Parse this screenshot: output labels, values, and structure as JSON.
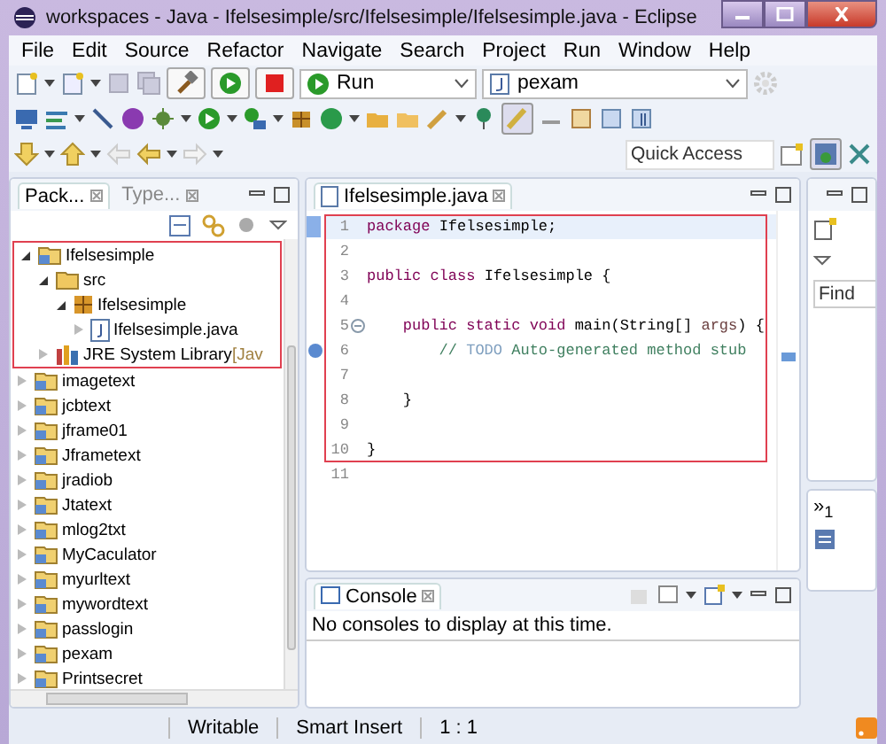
{
  "window": {
    "title": "workspaces - Java - Ifelsesimple/src/Ifelsesimple/Ifelsesimple.java - Eclipse"
  },
  "menu": [
    "File",
    "Edit",
    "Source",
    "Refactor",
    "Navigate",
    "Search",
    "Project",
    "Run",
    "Window",
    "Help"
  ],
  "toolbar": {
    "run_config": "Run",
    "launch_target": "pexam",
    "quick_access": {
      "placeholder": "Quick Access"
    }
  },
  "explorer": {
    "tabs": [
      {
        "label": "Pack...",
        "selected": true
      },
      {
        "label": "Type...",
        "selected": false
      }
    ],
    "tree": [
      {
        "label": "Ifelsesimple",
        "kind": "project",
        "expanded": true,
        "children": [
          {
            "label": "src",
            "kind": "folder",
            "expanded": true,
            "children": [
              {
                "label": "Ifelsesimple",
                "kind": "package",
                "expanded": true,
                "children": [
                  {
                    "label": "Ifelsesimple.java",
                    "kind": "java",
                    "expanded": false
                  }
                ]
              }
            ]
          },
          {
            "label": "JRE System Library",
            "suffix": "[Jav",
            "kind": "library",
            "expanded": false
          }
        ]
      },
      {
        "label": "imagetext",
        "kind": "project",
        "expanded": false
      },
      {
        "label": "jcbtext",
        "kind": "project",
        "expanded": false
      },
      {
        "label": "jframe01",
        "kind": "project",
        "expanded": false
      },
      {
        "label": "Jframetext",
        "kind": "project",
        "expanded": false
      },
      {
        "label": "jradiob",
        "kind": "project",
        "expanded": false
      },
      {
        "label": "Jtatext",
        "kind": "project",
        "expanded": false
      },
      {
        "label": "mlog2txt",
        "kind": "project",
        "expanded": false
      },
      {
        "label": "MyCaculator",
        "kind": "project",
        "expanded": false
      },
      {
        "label": "myurltext",
        "kind": "project",
        "expanded": false
      },
      {
        "label": "mywordtext",
        "kind": "project",
        "expanded": false
      },
      {
        "label": "passlogin",
        "kind": "project",
        "expanded": false
      },
      {
        "label": "pexam",
        "kind": "project",
        "expanded": false
      },
      {
        "label": "Printsecret",
        "kind": "project",
        "expanded": false
      }
    ]
  },
  "editor": {
    "tab": {
      "label": "Ifelsesimple.java",
      "selected": true
    },
    "lines": [
      {
        "number": "1",
        "current": true,
        "foldable": false,
        "tokens": [
          {
            "kind": "keyword",
            "text": "package"
          },
          {
            "kind": "plain",
            "text": " Ifelsesimple;"
          }
        ]
      },
      {
        "number": "2",
        "current": false,
        "foldable": false
      },
      {
        "number": "3",
        "current": false,
        "foldable": false,
        "tokens": [
          {
            "kind": "keyword",
            "text": "public class"
          },
          {
            "kind": "plain",
            "text": " Ifelsesimple {"
          }
        ]
      },
      {
        "number": "4",
        "current": false,
        "foldable": false
      },
      {
        "number": "5",
        "current": false,
        "foldable": true,
        "tokens": [
          {
            "kind": "keyword",
            "text": "    public static void"
          },
          {
            "kind": "plain",
            "text": " main(String[] "
          },
          {
            "kind": "param",
            "text": "args"
          },
          {
            "kind": "plain",
            "text": ") {"
          }
        ]
      },
      {
        "number": "6",
        "current": false,
        "foldable": false,
        "tokens": [
          {
            "kind": "comment",
            "text": "        // "
          },
          {
            "kind": "todo",
            "text": "TODO"
          },
          {
            "kind": "comment",
            "text": " Auto-generated method stub"
          }
        ]
      },
      {
        "number": "7",
        "current": false,
        "foldable": false
      },
      {
        "number": "8",
        "current": false,
        "foldable": false,
        "tokens": [
          {
            "kind": "plain",
            "text": "    }"
          }
        ]
      },
      {
        "number": "9",
        "current": false,
        "foldable": false
      },
      {
        "number": "10",
        "current": false,
        "foldable": false,
        "tokens": [
          {
            "kind": "plain",
            "text": "}"
          }
        ]
      },
      {
        "number": "11",
        "current": false,
        "foldable": false
      }
    ]
  },
  "outline": {
    "find_field": {
      "placeholder": "Find"
    },
    "minimized_label": "»$_{1}$"
  },
  "console": {
    "tab": {
      "label": "Console",
      "selected": true
    },
    "message": "No consoles to display at this time."
  },
  "status_bar": [
    "Writable",
    "Smart Insert",
    "1 : 1"
  ]
}
